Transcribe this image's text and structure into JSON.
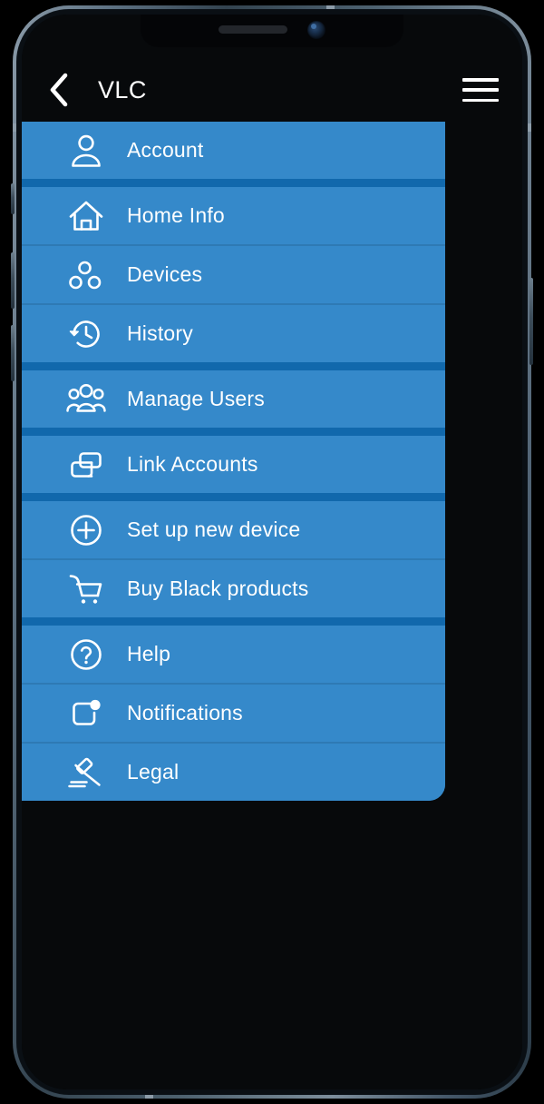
{
  "device": {
    "notch": {
      "speaker": "earpiece-speaker",
      "camera": "front-camera"
    }
  },
  "header": {
    "back_icon": "chevron-left-icon",
    "title": "VLC",
    "menu_icon": "hamburger-menu-icon"
  },
  "colors": {
    "menu_background": "#3589ca",
    "separator_thick": "#1168ac",
    "separator_thin": "#2e7ab4",
    "app_background": "#07090b",
    "text": "#ffffff"
  },
  "drawer": {
    "items": [
      {
        "label": "Account",
        "icon": "person-icon",
        "separator_after": "thick"
      },
      {
        "label": "Home Info",
        "icon": "house-icon",
        "separator_after": "thin"
      },
      {
        "label": "Devices",
        "icon": "devices-dots-icon",
        "separator_after": "thin"
      },
      {
        "label": "History",
        "icon": "clock-history-icon",
        "separator_after": "thick"
      },
      {
        "label": "Manage Users",
        "icon": "people-group-icon",
        "separator_after": "thick"
      },
      {
        "label": "Link Accounts",
        "icon": "link-frames-icon",
        "separator_after": "thick"
      },
      {
        "label": "Set up new device",
        "icon": "plus-circle-icon",
        "separator_after": "thin"
      },
      {
        "label": "Buy Black products",
        "icon": "shopping-cart-icon",
        "separator_after": "thick"
      },
      {
        "label": "Help",
        "icon": "question-circle-icon",
        "separator_after": "thin"
      },
      {
        "label": "Notifications",
        "icon": "notification-badge-icon",
        "separator_after": "thin"
      },
      {
        "label": "Legal",
        "icon": "gavel-icon",
        "separator_after": "none"
      }
    ]
  }
}
